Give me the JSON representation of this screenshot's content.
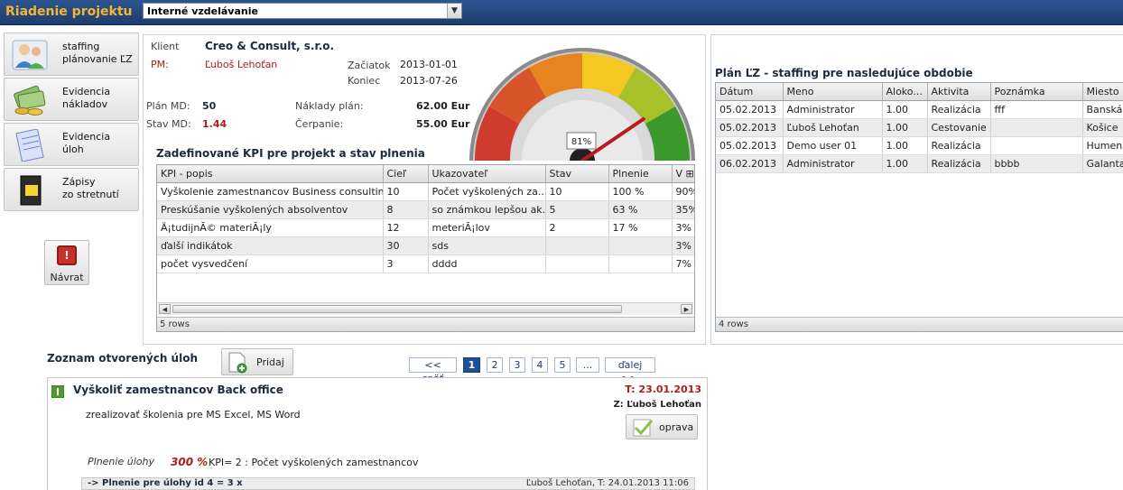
{
  "header": {
    "app_title": "Riadenie projektu",
    "project_select": "Interné vzdelávanie"
  },
  "nav": {
    "items": [
      {
        "label_1": "staffing",
        "label_2": "plánovanie ĽZ",
        "icon": "people-icon"
      },
      {
        "label_1": "Evidencia",
        "label_2": "nákladov",
        "icon": "money-icon"
      },
      {
        "label_1": "Evidencia",
        "label_2": "úloh",
        "icon": "notepad-icon"
      },
      {
        "label_1": "Zápisy",
        "label_2": "zo stretnutí",
        "icon": "notebook-icon"
      }
    ],
    "back_label": "Návrat"
  },
  "project": {
    "client_label": "Klient",
    "client_value": "Creo & Consult, s.r.o.",
    "pm_label": "PM:",
    "pm_value": "Ľuboš Lehoťan",
    "start_label": "Začiatok",
    "start_value": "2013-01-01",
    "end_label": "Koniec",
    "end_value": "2013-07-26",
    "plan_md_label": "Plán MD:",
    "plan_md_value": "50",
    "stav_md_label": "Stav MD:",
    "stav_md_value": "1.44",
    "naklady_label": "Náklady plán:",
    "naklady_value": "62.00 Eur",
    "cerpanie_label": "Čerpanie:",
    "cerpanie_value": "55.00 Eur",
    "gauge_label": "81%",
    "gauge_percent": 81
  },
  "kpi": {
    "title": "Zadefinované KPI pre projekt a stav plnenia",
    "columns": [
      "KPI - popis",
      "Cieľ",
      "Ukazovateľ",
      "Stav",
      "Plnenie",
      "V"
    ],
    "rows": [
      [
        "Vyškolenie zamestnancov Business consultingu",
        "10",
        "Počet vyškolených za...",
        "10",
        "100 %",
        "90%"
      ],
      [
        "Preskúšanie vyškolených absolventov",
        "8",
        "so známkou lepšou ak...",
        "5",
        "63 %",
        "35%"
      ],
      [
        "Ä¡tudijnĂ© materiĂ¡ly",
        "12",
        "meteriĂ¡lov",
        "2",
        "17 %",
        "3%"
      ],
      [
        "ďalší indikátok",
        "30",
        "sds",
        "",
        "",
        "3%"
      ],
      [
        "počet vysvedčení",
        "3",
        "dddd",
        "",
        "",
        "7%"
      ]
    ],
    "footer": "5 rows"
  },
  "staffing": {
    "title": "Plán ĽZ - staffing pre nasledujúce obdobie",
    "columns": [
      "Dátum",
      "Meno",
      "Aloko...",
      "Aktivita",
      "Poznámka",
      "Miesto pl"
    ],
    "rows": [
      [
        "05.02.2013",
        "Administrator",
        "1.00",
        "Realizácia",
        "fff",
        "Banská B"
      ],
      [
        "05.02.2013",
        "Ľuboš Lehoťan",
        "1.00",
        "Cestovanie",
        "",
        "Košice"
      ],
      [
        "05.02.2013",
        "Demo user 01",
        "1.00",
        "Realizácia",
        "",
        "Humenne"
      ],
      [
        "06.02.2013",
        "Administrator",
        "1.00",
        "Realizácia",
        "bbbb",
        "Galanta"
      ]
    ],
    "footer": "4 rows"
  },
  "tasks": {
    "title": "Zoznam otvorených úloh",
    "add_label": "Pridaj",
    "pager": {
      "prev": "<< späť",
      "pages": [
        "1",
        "2",
        "3",
        "4",
        "5",
        "..."
      ],
      "active": "1",
      "next": "ďalej >>"
    },
    "item": {
      "title": "Vyškoliť zamestnancov Back office",
      "term": "T: 23.01.2013",
      "owner": "Z: Ľuboš Lehoťan",
      "description": "zrealizovať školenia pre MS Excel, MS Word",
      "edit_label": "oprava",
      "plnenie_label": "Plnenie úlohy",
      "plnenie_value": "300 %",
      "kpi_text": "KPI= 2 : Počet vyškolených zamestnancov",
      "sub_text": "-> Plnenie pre úlohy id 4 = 3 x",
      "sub_meta": "Ľuboš Lehoťan, T: 24.01.2013 11:06"
    }
  }
}
